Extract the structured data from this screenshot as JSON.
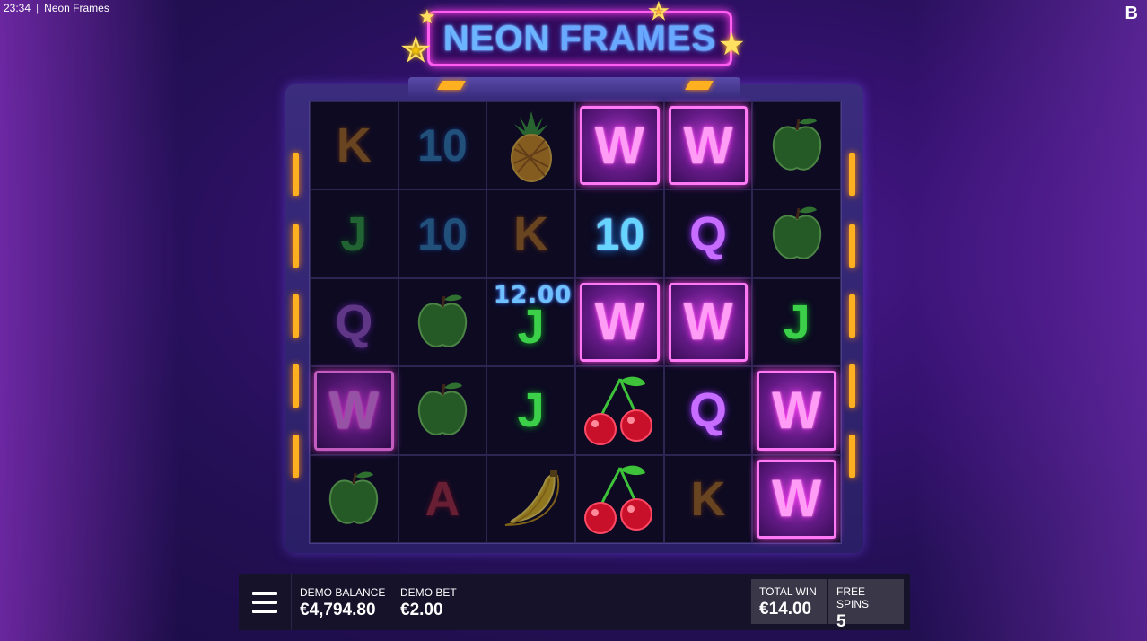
{
  "status": {
    "time": "23:34",
    "separator": "|",
    "window_title": "Neon Frames"
  },
  "brand_mark": "B",
  "logo": {
    "word1": "NEON",
    "word2": "FRAMES"
  },
  "grid": {
    "columns": 6,
    "rows": [
      [
        "K",
        "10",
        "pineapple",
        "W",
        "W",
        "apple"
      ],
      [
        "J",
        "10",
        "K",
        "10",
        "Q",
        "apple"
      ],
      [
        "Q",
        "apple",
        "J",
        "W",
        "W",
        "J"
      ],
      [
        "W",
        "apple",
        "J",
        "cherry",
        "Q",
        "W"
      ],
      [
        "apple",
        "A",
        "banana",
        "cherry",
        "K",
        "W"
      ]
    ],
    "highlighted": [
      "0-3",
      "0-4",
      "1-3",
      "1-4",
      "2-2",
      "2-3",
      "2-4",
      "2-5",
      "3-0",
      "3-2",
      "3-3",
      "3-4",
      "3-5",
      "4-3",
      "4-5"
    ]
  },
  "win_popup": "12.00",
  "bottom_bar": {
    "menu_icon": "hamburger-menu-icon",
    "balance_label": "DEMO BALANCE",
    "balance_value": "€4,794.80",
    "bet_label": "DEMO BET",
    "bet_value": "€2.00",
    "total_win_label": "TOTAL WIN",
    "total_win_value": "€14.00",
    "free_spins_label": "FREE SPINS",
    "free_spins_value": "5"
  },
  "colors": {
    "accent": "#ff5cf0",
    "wild": "#ff9cf6",
    "frame": "#3b2c7e",
    "bar": "#15122a",
    "led": "#ffb020"
  }
}
